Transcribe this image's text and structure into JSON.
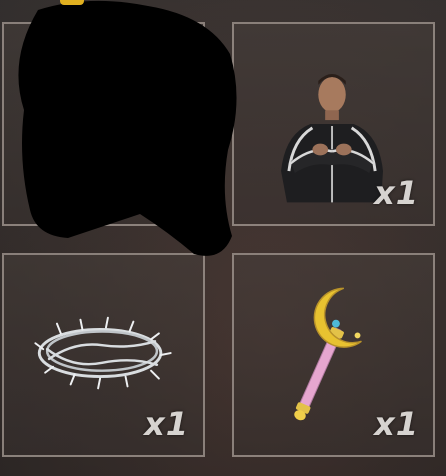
{
  "inventory": {
    "slots": [
      {
        "item": "",
        "quantity": ""
      },
      {
        "item": "man-in-tracksuit-icon",
        "quantity": "x1"
      },
      {
        "item": "crown-of-thorns-icon",
        "quantity": "x1"
      },
      {
        "item": "moon-wand-icon",
        "quantity": "x1"
      }
    ]
  },
  "colors": {
    "background": "#3a302d",
    "slot_border": "#a59b94",
    "quantity_text": "#ebe8e4",
    "wand_moon": "#e8c230",
    "wand_handle": "#e6a6cf"
  }
}
